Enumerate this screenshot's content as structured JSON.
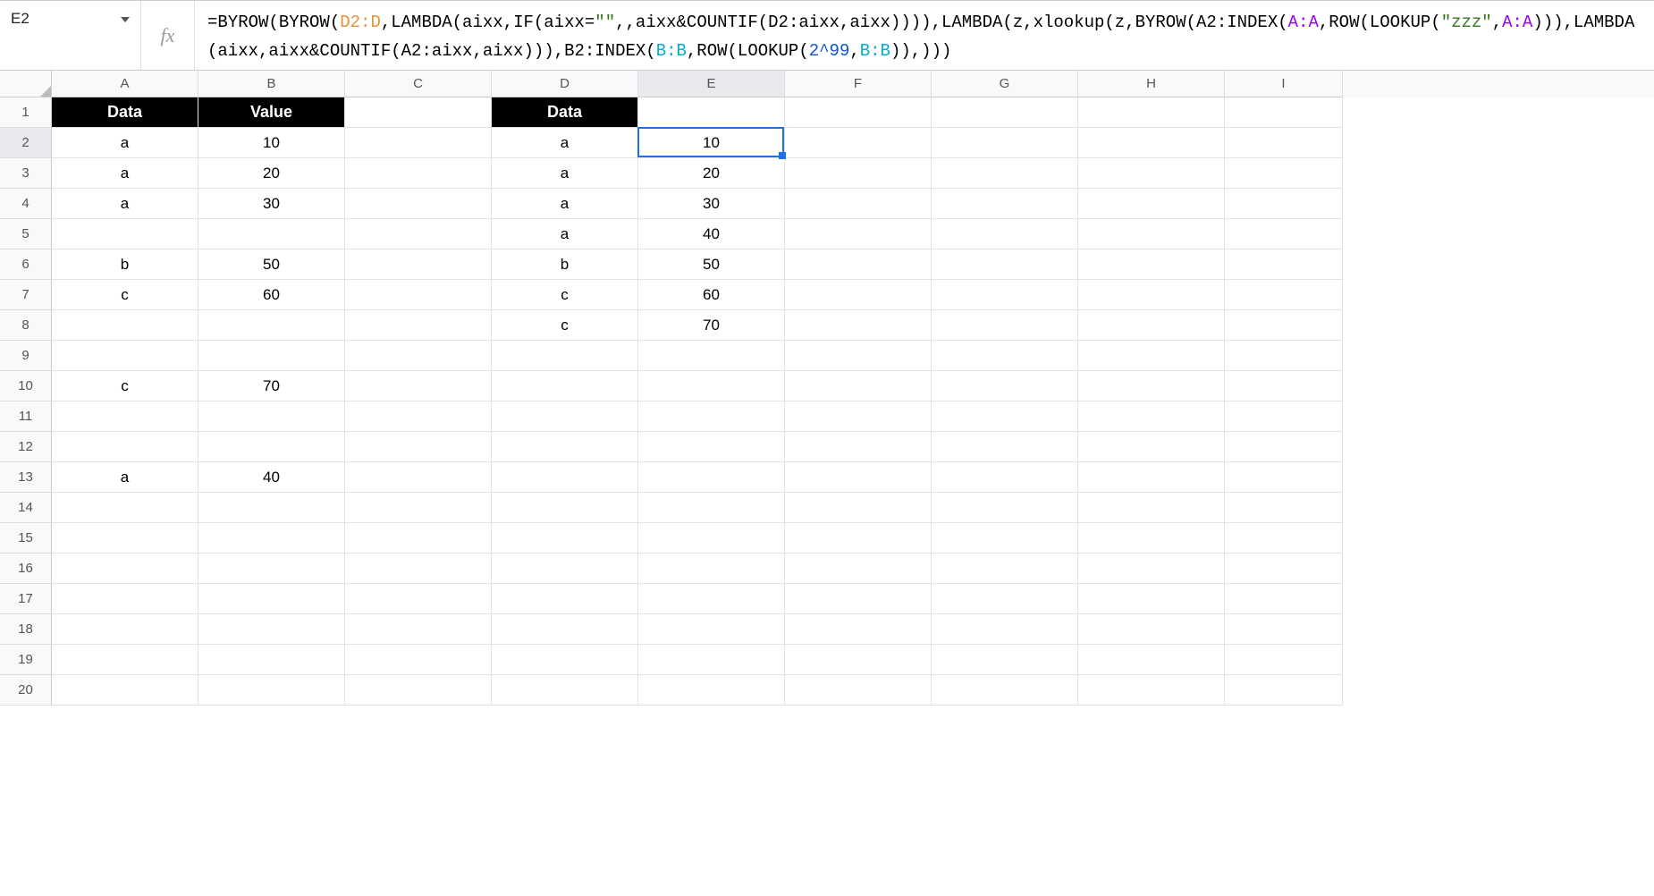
{
  "name_box": {
    "value": "E2"
  },
  "fx_label": "fx",
  "formula": {
    "segments": [
      {
        "t": "=BYROW(BYROW(",
        "c": ""
      },
      {
        "t": "D2:D",
        "c": "tok-orange"
      },
      {
        "t": ",LAMBDA(aixx,IF(aixx=",
        "c": ""
      },
      {
        "t": "\"\"",
        "c": "tok-green"
      },
      {
        "t": ",,aixx&COUNTIF(D2:aixx,aixx)))),LAMBDA(z,xlookup(z,BYROW(A2:INDEX(",
        "c": ""
      },
      {
        "t": "A:A",
        "c": "tok-purple"
      },
      {
        "t": ",ROW(LOOKUP(",
        "c": ""
      },
      {
        "t": "\"zzz\"",
        "c": "tok-green"
      },
      {
        "t": ",",
        "c": ""
      },
      {
        "t": "A:A",
        "c": "tok-purple"
      },
      {
        "t": "))),LAMBDA(aixx,aixx&COUNTIF(A2:aixx,aixx))),B2:INDEX(",
        "c": ""
      },
      {
        "t": "B:B",
        "c": "tok-teal"
      },
      {
        "t": ",ROW(LOOKUP(",
        "c": ""
      },
      {
        "t": "2^99",
        "c": "tok-blue"
      },
      {
        "t": ",",
        "c": ""
      },
      {
        "t": "B:B",
        "c": "tok-teal"
      },
      {
        "t": ")),)))",
        "c": ""
      }
    ]
  },
  "columns": [
    "A",
    "B",
    "C",
    "D",
    "E",
    "F",
    "G",
    "H",
    "I"
  ],
  "num_rows": 20,
  "headers": {
    "A1": "Data",
    "B1": "Value",
    "D1": "Data"
  },
  "cells": {
    "A2": "a",
    "B2": "10",
    "D2": "a",
    "E2": "10",
    "A3": "a",
    "B3": "20",
    "D3": "a",
    "E3": "20",
    "A4": "a",
    "B4": "30",
    "D4": "a",
    "E4": "30",
    "D5": "a",
    "E5": "40",
    "A6": "b",
    "B6": "50",
    "D6": "b",
    "E6": "50",
    "A7": "c",
    "B7": "60",
    "D7": "c",
    "E7": "60",
    "D8": "c",
    "E8": "70",
    "A10": "c",
    "B10": "70",
    "A13": "a",
    "B13": "40"
  },
  "active_cell": "E2",
  "active_col": "E",
  "active_row": 2,
  "colors": {
    "selection": "#1a73e8",
    "header_bg": "#000000",
    "header_fg": "#ffffff"
  }
}
